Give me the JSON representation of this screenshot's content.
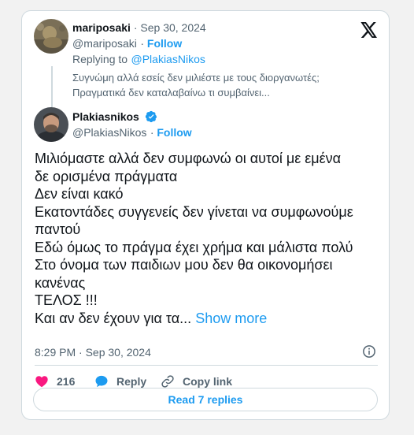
{
  "reply_to_tweet": {
    "display_name": "mariposaki",
    "date": "Sep 30, 2024",
    "handle": "@mariposaki",
    "follow_label": "Follow",
    "replying_prefix": "Replying to",
    "replying_handle": "@PlakiasNikos",
    "text_lines": [
      "Συγνώμη αλλά εσείς δεν μιλιέστε με τους διοργανωτές;",
      "Πραγματικά δεν καταλαβαίνω τι συμβαίνει..."
    ]
  },
  "main_tweet": {
    "display_name": "Plakiasnikos",
    "verified": true,
    "handle": "@PlakiasNikos",
    "follow_label": "Follow",
    "text_lines": [
      "Μιλιόμαστε αλλά δεν συμφωνώ οι αυτοί με εμένα",
      "δε ορισμένα πράγματα",
      "Δεν είναι κακό",
      "Εκατοντάδες συγγενείς δεν γίνεται να συμφωνούμε",
      "παντού",
      "Εδώ όμως το πράγμα έχει χρήμα και μάλιστα πολύ",
      "Στο όνομα των παιδιων μου δεν θα οικονομήσει",
      "κανένας",
      "ΤΕΛΟΣ !!!",
      "Και αν δεν έχουν για τα..."
    ],
    "show_more_label": "Show more",
    "timestamp": "8:29 PM · Sep 30, 2024"
  },
  "actions": {
    "likes_count": "216",
    "reply_label": "Reply",
    "copy_link_label": "Copy link"
  },
  "read_replies_label": "Read 7 replies",
  "colors": {
    "accent": "#1d9bf0",
    "like": "#f91880",
    "muted": "#536471",
    "border": "#cfd9de"
  },
  "icons": [
    "x-logo-icon",
    "verified-badge-icon",
    "info-icon",
    "heart-icon",
    "reply-bubble-icon",
    "link-icon"
  ]
}
